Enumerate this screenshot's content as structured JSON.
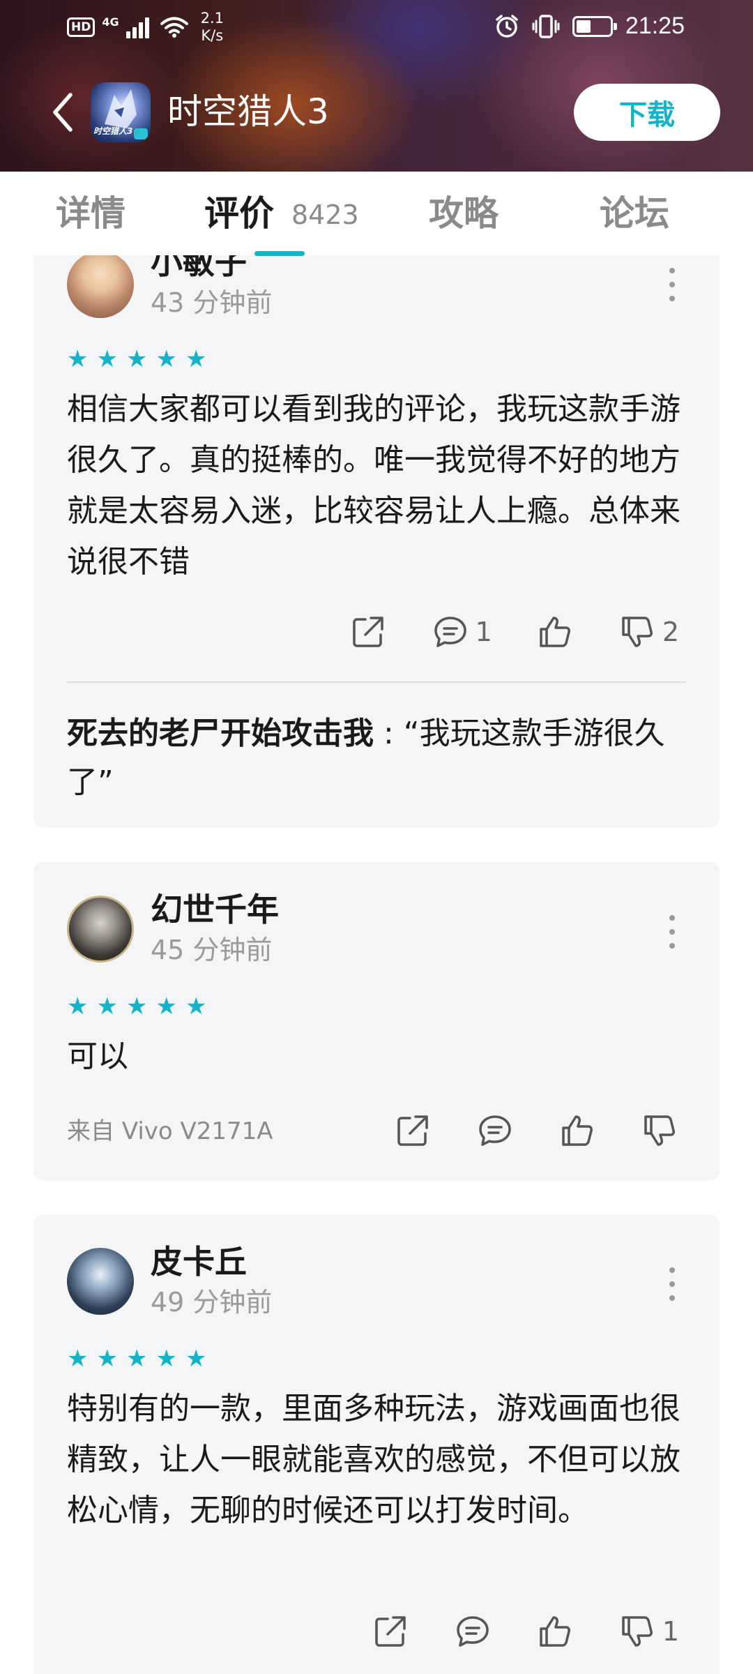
{
  "status_bar": {
    "hd": "HD",
    "signal": "4G",
    "speed_value": "2.1",
    "speed_unit": "K/s",
    "time": "21:25"
  },
  "app_bar": {
    "app_name": "时空猎人3",
    "download_label": "下载",
    "icon_text": "时空猎人3"
  },
  "tabs": [
    {
      "label": "详情"
    },
    {
      "label": "评价",
      "count": "8423"
    },
    {
      "label": "攻略"
    },
    {
      "label": "论坛"
    }
  ],
  "reviews": [
    {
      "user": "小敏子",
      "time": "43 分钟前",
      "stars": 5,
      "text": "相信大家都可以看到我的评论，我玩这款手游很久了。真的挺棒的。唯一我觉得不好的地方就是太容易入迷，比较容易让人上瘾。总体来说很不错",
      "comments": "1",
      "dislikes": "2",
      "reply_user": "死去的老尸开始攻击我",
      "reply_sep": " : ",
      "reply_text": "“我玩这款手游很久了”"
    },
    {
      "user": "幻世千年",
      "time": "45 分钟前",
      "stars": 5,
      "text": "可以",
      "device": "来自 Vivo V2171A"
    },
    {
      "user": "皮卡丘",
      "time": "49 分钟前",
      "stars": 5,
      "text": "特别有的一款，里面多种玩法，游戏画面也很精致，让人一眼就能喜欢的感觉，不但可以放松心情，无聊的时候还可以打发时间。",
      "dislikes": "1"
    }
  ],
  "colors": {
    "accent": "#14b3c6",
    "card_bg": "#f4f5f7",
    "muted_text": "#9a9a9a"
  }
}
